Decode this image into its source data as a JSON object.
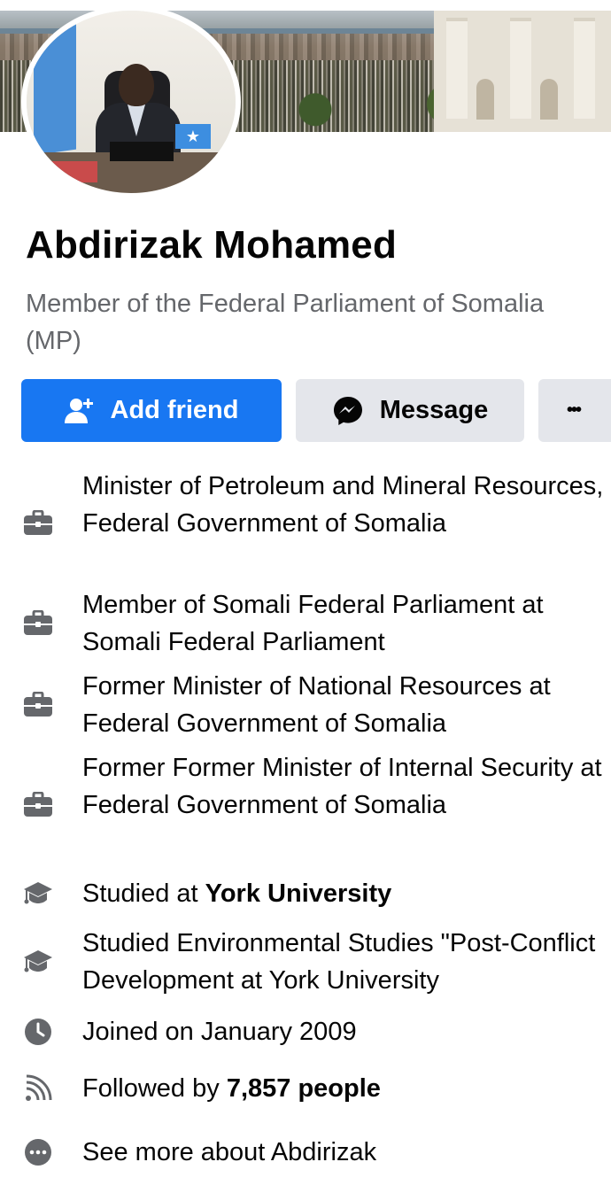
{
  "profile": {
    "name": "Abdirizak Mohamed",
    "bio": "Member of the Federal Parliament of Somalia (MP)"
  },
  "actions": {
    "add_friend_label": "Add friend",
    "message_label": "Message",
    "more_label": "•••"
  },
  "details": [
    {
      "icon": "briefcase-icon",
      "text": "Minister of Petroleum and Mineral Resources, Federal Government of Somalia"
    },
    {
      "icon": "briefcase-icon",
      "text": "Member of Somali Federal Parliament at Somali Federal Parliament"
    },
    {
      "icon": "briefcase-icon",
      "text": "Former Minister of National Resources at Federal Government of Somalia"
    },
    {
      "icon": "briefcase-icon",
      "text": "Former Former Minister of Internal Security at Federal Government of Somalia"
    },
    {
      "icon": "graduation-cap-icon",
      "prefix": "Studied at ",
      "emphasis": "York University"
    },
    {
      "icon": "graduation-cap-icon",
      "text": "Studied Environmental Studies \"Post-Conflict Development at York University"
    },
    {
      "icon": "clock-icon",
      "text": "Joined on January 2009"
    },
    {
      "icon": "rss-feed-icon",
      "prefix": "Followed by ",
      "emphasis": "7,857 people"
    },
    {
      "icon": "more-dots-icon",
      "text": "See more about Abdirizak"
    }
  ],
  "colors": {
    "primary_blue": "#1877f2",
    "secondary_button": "#e4e6eb",
    "text_primary": "#050505",
    "text_secondary": "#65676b",
    "icon_gray": "#65676b"
  }
}
